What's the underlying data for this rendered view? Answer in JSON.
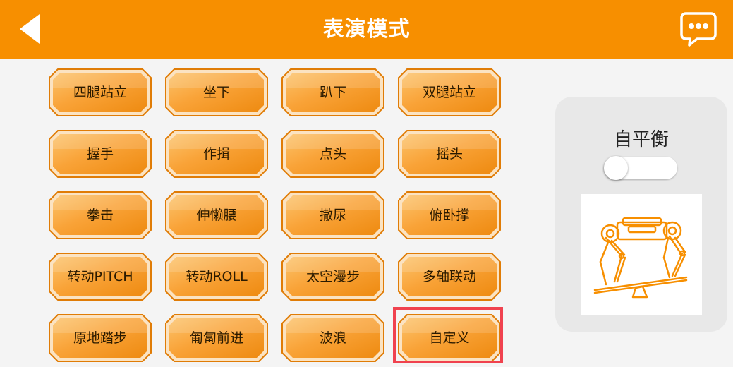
{
  "header": {
    "title": "表演模式",
    "back_icon": "back-arrow-icon",
    "chat_icon": "chat-bubble-icon"
  },
  "actions": [
    {
      "label": "四腿站立"
    },
    {
      "label": "坐下"
    },
    {
      "label": "趴下"
    },
    {
      "label": "双腿站立"
    },
    {
      "label": "握手"
    },
    {
      "label": "作揖"
    },
    {
      "label": "点头"
    },
    {
      "label": "摇头"
    },
    {
      "label": "拳击"
    },
    {
      "label": "伸懒腰"
    },
    {
      "label": "撒尿"
    },
    {
      "label": "俯卧撑"
    },
    {
      "label": "转动PITCH"
    },
    {
      "label": "转动ROLL"
    },
    {
      "label": "太空漫步"
    },
    {
      "label": "多轴联动"
    },
    {
      "label": "原地踏步"
    },
    {
      "label": "匍匐前进"
    },
    {
      "label": "波浪"
    },
    {
      "label": "自定义"
    }
  ],
  "selected_action": "自定义",
  "balance_panel": {
    "title": "自平衡",
    "toggle_on": false,
    "illustration_icon": "robot-dog-balance-icon"
  },
  "colors": {
    "accent": "#f78f00",
    "button_gold": "#f9a338",
    "highlight": "#f0424f"
  }
}
